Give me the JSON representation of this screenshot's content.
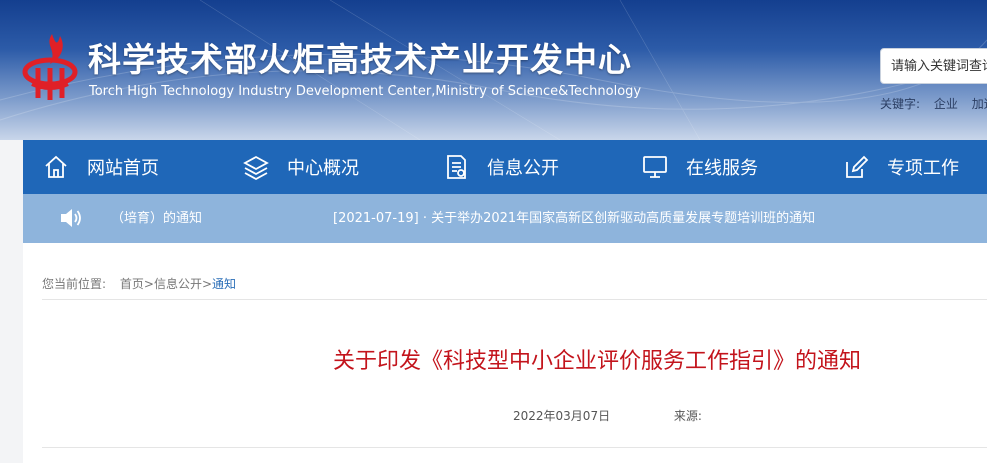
{
  "header": {
    "title": "科学技术部火炬高技术产业开发中心",
    "subtitle": "Torch High Technology Industry Development Center,Ministry of Science&Technology",
    "search_placeholder": "请输入关键词查询",
    "keywords_label": "关键字:",
    "keywords": [
      "企业",
      "加速"
    ]
  },
  "nav": {
    "items": [
      {
        "label": "网站首页",
        "icon": "home-icon"
      },
      {
        "label": "中心概况",
        "icon": "layers-icon"
      },
      {
        "label": "信息公开",
        "icon": "document-icon"
      },
      {
        "label": "在线服务",
        "icon": "monitor-icon"
      },
      {
        "label": "专项工作",
        "icon": "edit-icon"
      }
    ]
  },
  "ticker": {
    "items": [
      "（培育）的通知",
      "[2021-07-19] · 关于举办2021年国家高新区创新驱动高质量发展专题培训班的通知"
    ]
  },
  "breadcrumb": {
    "label": "您当前位置:",
    "items": [
      "首页",
      "信息公开",
      "通知"
    ],
    "separator": ">"
  },
  "article": {
    "title": "关于印发《科技型中小企业评价服务工作指引》的通知",
    "date": "2022年03月07日",
    "source_label": "来源:"
  },
  "colors": {
    "nav_bg": "#1f67b8",
    "ticker_bg": "#8eb4dc",
    "title_red": "#c3141c",
    "link_blue": "#2c6fb8"
  }
}
